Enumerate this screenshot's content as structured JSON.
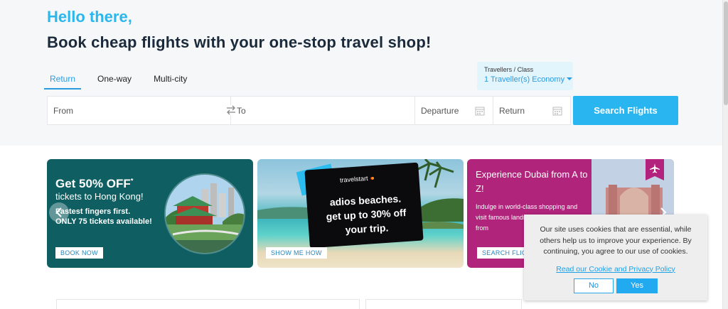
{
  "header": {
    "greeting": "Hello there,",
    "headline": "Book cheap flights with your one-stop travel shop!"
  },
  "trip_tabs": [
    {
      "label": "Return",
      "active": true
    },
    {
      "label": "One-way",
      "active": false
    },
    {
      "label": "Multi-city",
      "active": false
    }
  ],
  "travellers": {
    "label": "Travellers / Class",
    "value": "1 Traveller(s) Economy"
  },
  "search": {
    "from_placeholder": "From",
    "to_placeholder": "To",
    "departure_placeholder": "Departure",
    "return_placeholder": "Return",
    "button_label": "Search Flights"
  },
  "promos": {
    "hong_kong": {
      "title": "Get 50% OFF",
      "title_mark": "*",
      "subtitle": "tickets to Hong Kong!",
      "line1": "Fastest fingers first.",
      "line2": "ONLY 75 tickets available!",
      "button": "BOOK NOW"
    },
    "beaches": {
      "logo": "travelstart",
      "line1": "adios beaches.",
      "line2": "get up to 30% off",
      "line3": "your trip.",
      "button": "SHOW ME HOW"
    },
    "dubai": {
      "title": "Experience Dubai from A to Z!",
      "body": "Indulge in world-class shopping and visit famous landmarks. book NOW from",
      "button": "SEARCH FLIGHTS"
    }
  },
  "cookie": {
    "text": "Our site uses cookies that are essential, while others help us to improve your experience. By continuing, you agree to our use of cookies.",
    "link": "Read our Cookie and Privacy Policy",
    "no_label": "No",
    "yes_label": "Yes"
  },
  "colors": {
    "accent": "#29b6f0",
    "greeting": "#2bb7ec",
    "headline": "#1b2a3a",
    "hk_bg": "#0f5f62",
    "dubai_bg": "#b0247b"
  }
}
